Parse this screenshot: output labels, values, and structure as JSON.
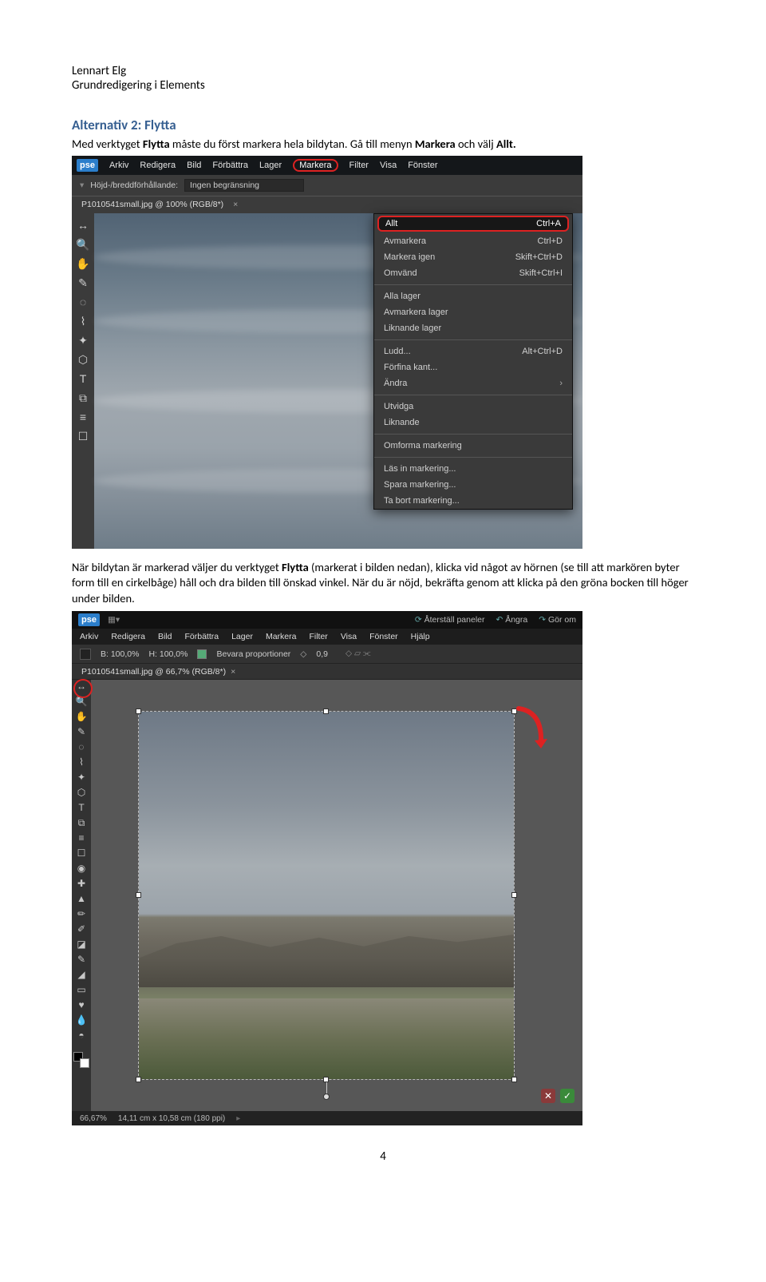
{
  "doc": {
    "author": "Lennart Elg",
    "subject": "Grundredigering  i Elements",
    "heading": "Alternativ 2: Flytta",
    "p1a": "Med verktyget ",
    "p1b": "Flytta",
    "p1c": " måste du först markera hela bildytan. Gå till menyn ",
    "p1d": "Markera",
    "p1e": " och välj ",
    "p1f": "Allt.",
    "p2a": "När bildytan är markerad väljer du verktyget ",
    "p2b": "Flytta",
    "p2c": " (markerat i bilden nedan), klicka vid något av hörnen (se till att markören byter form till en cirkelbåge) håll och dra bilden till önskad vinkel. När du är nöjd, bekräfta genom att klicka på den gröna bocken till höger under bilden.",
    "pageno": "4"
  },
  "s1": {
    "menus": [
      "Arkiv",
      "Redigera",
      "Bild",
      "Förbättra",
      "Lager",
      "Markera",
      "Filter",
      "Visa",
      "Fönster"
    ],
    "ratioLabel": "Höjd-/breddförhållande:",
    "ratioValue": "Ingen begränsning",
    "tab": "P1010541small.jpg @ 100% (RGB/8*)",
    "dropdown": {
      "allt": "Allt",
      "allt_sc": "Ctrl+A",
      "avm": "Avmarkera",
      "avm_sc": "Ctrl+D",
      "igen": "Markera igen",
      "igen_sc": "Skift+Ctrl+D",
      "omv": "Omvänd",
      "omv_sc": "Skift+Ctrl+I",
      "alla": "Alla lager",
      "avml": "Avmarkera lager",
      "likn": "Liknande lager",
      "ludd": "Ludd...",
      "ludd_sc": "Alt+Ctrl+D",
      "kant": "Förfina kant...",
      "andra": "Ändra",
      "utv": "Utvidga",
      "lik2": "Liknande",
      "omf": "Omforma markering",
      "las": "Läs in markering...",
      "spar": "Spara markering...",
      "bort": "Ta bort markering..."
    }
  },
  "s2": {
    "topRight": {
      "reset": "Återställ paneler",
      "undo": "Ångra",
      "redo": "Gör om"
    },
    "menus": [
      "Arkiv",
      "Redigera",
      "Bild",
      "Förbättra",
      "Lager",
      "Markera",
      "Filter",
      "Visa",
      "Fönster",
      "Hjälp"
    ],
    "opts": {
      "b": "B: 100,0%",
      "h": "H: 100,0%",
      "keep": "Bevara proportioner",
      "ang": "0,9"
    },
    "tab": "P1010541small.jpg @ 66,7% (RGB/8*)",
    "status": {
      "zoom": "66,67%",
      "dims": "14,11 cm x 10,58 cm (180 ppi)"
    }
  },
  "chart_data": null
}
